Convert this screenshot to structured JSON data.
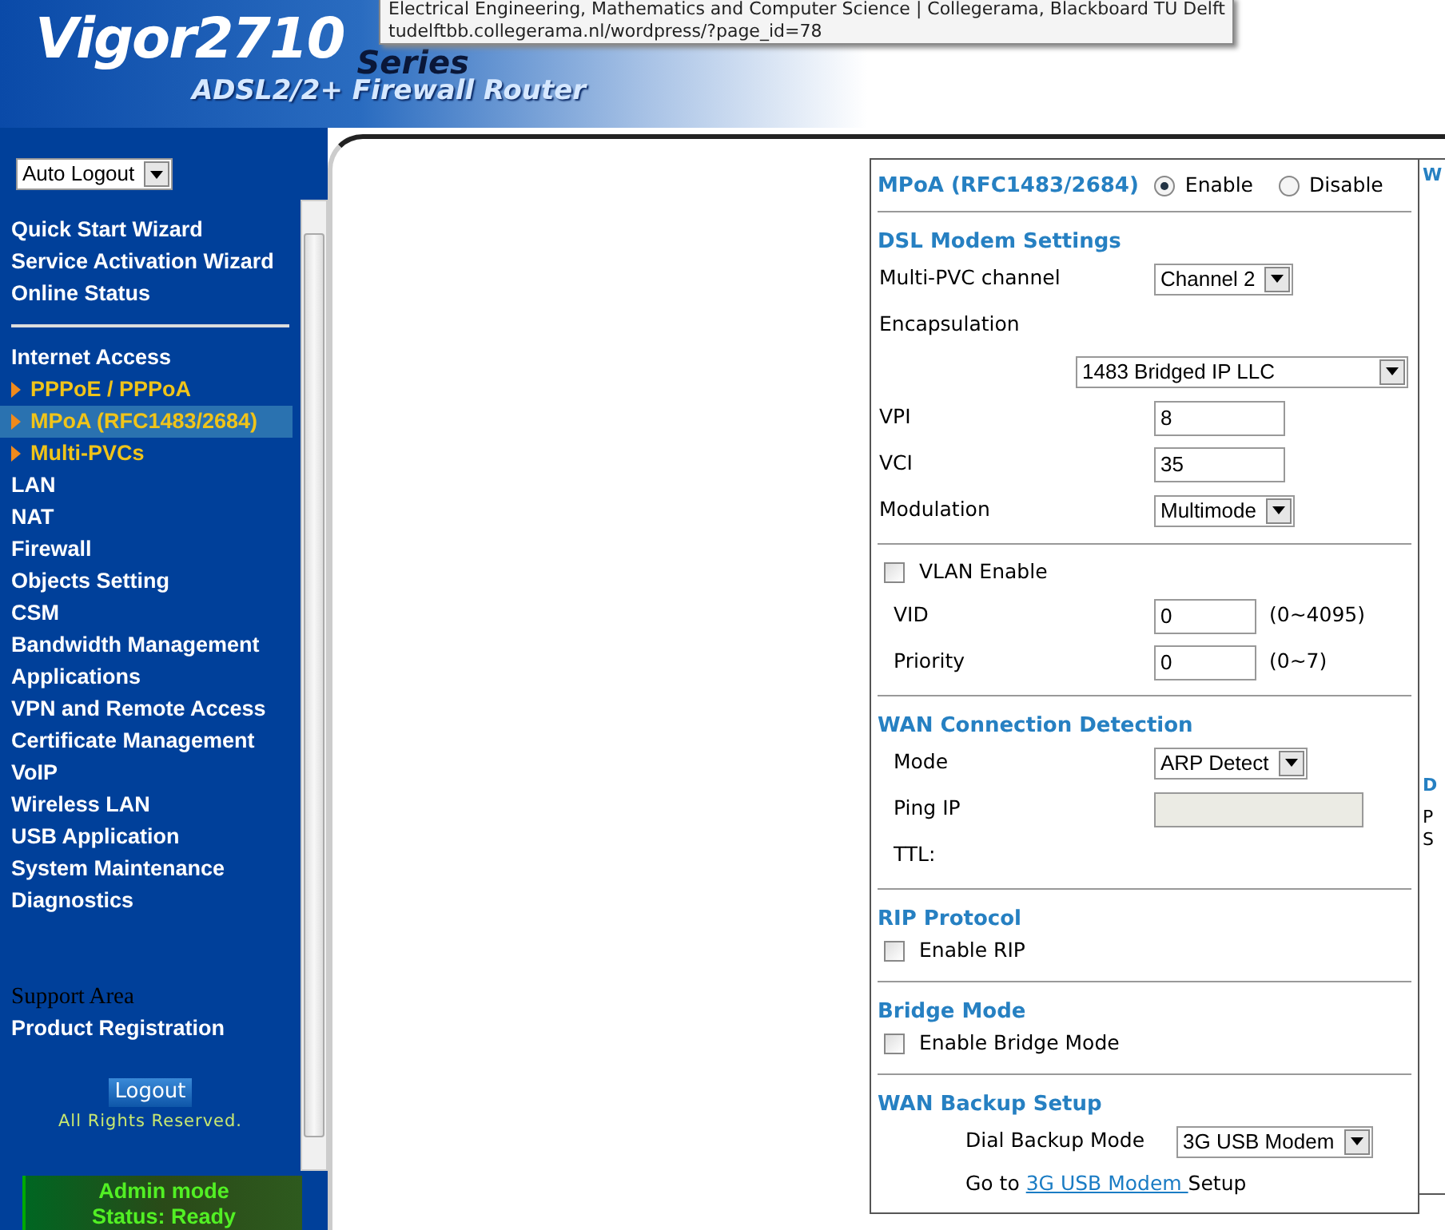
{
  "tooltip": {
    "title": "Electrical Engineering, Mathematics and Computer Science | Collegerama, Blackboard TU Delft",
    "url": "tudelftbb.collegerama.nl/wordpress/?page_id=78"
  },
  "banner": {
    "model": "Vigor2710",
    "series": "Series",
    "subtitle": "ADSL2/2+ Firewall Router"
  },
  "sidebar": {
    "auto_logout": "Auto Logout",
    "items": [
      {
        "label": "Quick Start Wizard",
        "kind": "main",
        "selected": false
      },
      {
        "label": "Service Activation Wizard",
        "kind": "main",
        "selected": false
      },
      {
        "label": "Online Status",
        "kind": "main",
        "selected": false
      },
      {
        "kind": "divider"
      },
      {
        "label": "Internet Access",
        "kind": "main",
        "selected": false
      },
      {
        "label": "PPPoE / PPPoA",
        "kind": "sub",
        "selected": false
      },
      {
        "label": "MPoA (RFC1483/2684)",
        "kind": "sub",
        "selected": true
      },
      {
        "label": "Multi-PVCs",
        "kind": "sub",
        "selected": false
      },
      {
        "label": "LAN",
        "kind": "main",
        "selected": false
      },
      {
        "label": "NAT",
        "kind": "main",
        "selected": false
      },
      {
        "label": "Firewall",
        "kind": "main",
        "selected": false
      },
      {
        "label": "Objects Setting",
        "kind": "main",
        "selected": false
      },
      {
        "label": "CSM",
        "kind": "main",
        "selected": false
      },
      {
        "label": "Bandwidth Management",
        "kind": "main",
        "selected": false
      },
      {
        "label": "Applications",
        "kind": "main",
        "selected": false
      },
      {
        "label": "VPN and Remote Access",
        "kind": "main",
        "selected": false
      },
      {
        "label": "Certificate Management",
        "kind": "main",
        "selected": false
      },
      {
        "label": "VoIP",
        "kind": "main",
        "selected": false
      },
      {
        "label": "Wireless LAN",
        "kind": "main",
        "selected": false
      },
      {
        "label": "USB Application",
        "kind": "main",
        "selected": false
      },
      {
        "label": "System Maintenance",
        "kind": "main",
        "selected": false
      },
      {
        "label": "Diagnostics",
        "kind": "main",
        "selected": false
      }
    ],
    "support_title": "Support Area",
    "support_link": "Product Registration",
    "logout": "Logout",
    "copyright": "All Rights Reserved.",
    "mode": "Admin mode",
    "status": "Status: Ready"
  },
  "form": {
    "title": "MPoA (RFC1483/2684)",
    "radios": [
      {
        "label": "Enable",
        "selected": true
      },
      {
        "label": "Disable",
        "selected": false
      }
    ],
    "sections": [
      {
        "heading": "DSL Modem Settings",
        "rows": [
          {
            "kind": "select",
            "label": "Multi-PVC channel",
            "value": "Channel 2"
          },
          {
            "kind": "label",
            "label": "Encapsulation"
          },
          {
            "kind": "wide-select",
            "value": "1483 Bridged IP LLC"
          },
          {
            "kind": "input",
            "label": "VPI",
            "value": "8"
          },
          {
            "kind": "input",
            "label": "VCI",
            "value": "35"
          },
          {
            "kind": "select",
            "label": "Modulation",
            "value": "Multimode"
          }
        ]
      },
      {
        "rows": [
          {
            "kind": "check",
            "label": "VLAN Enable",
            "checked": false
          },
          {
            "kind": "input",
            "label": "VID",
            "value": "0",
            "hint": "(0~4095)"
          },
          {
            "kind": "input",
            "label": "Priority",
            "value": "0",
            "hint": "(0~7)"
          }
        ]
      },
      {
        "heading": "WAN Connection Detection",
        "rows": [
          {
            "kind": "select",
            "label": "Mode",
            "value": "ARP Detect"
          },
          {
            "kind": "input",
            "label": "Ping IP",
            "disabled": true
          },
          {
            "kind": "label",
            "label": "TTL:"
          }
        ]
      },
      {
        "heading": "RIP Protocol",
        "rows": [
          {
            "kind": "check",
            "label": "Enable RIP",
            "checked": false
          }
        ]
      },
      {
        "heading": "Bridge Mode",
        "rows": [
          {
            "kind": "check",
            "label": "Enable Bridge Mode",
            "checked": false
          }
        ]
      },
      {
        "heading": "WAN Backup Setup",
        "rows": [
          {
            "kind": "backup-select",
            "label": "Dial Backup Mode",
            "value": "3G USB Modem"
          },
          {
            "kind": "link-line",
            "before": "Go to ",
            "link": "3G USB Modem ",
            "after": "Setup"
          }
        ]
      }
    ]
  },
  "right_panel": {
    "texts": [
      "W",
      "D",
      "P",
      "S"
    ]
  }
}
